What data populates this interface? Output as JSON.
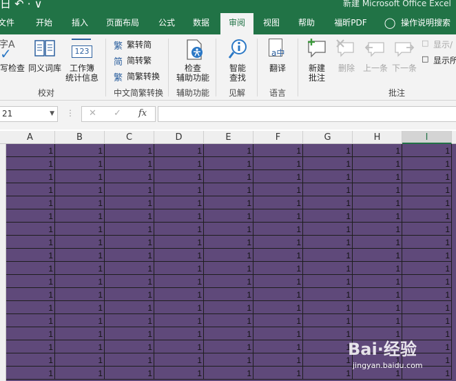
{
  "titlebar": {
    "qat": "日 ↶ · ∨",
    "title": "新建 Microsoft Office Excel"
  },
  "tabs": [
    {
      "label": "文件",
      "active": false
    },
    {
      "label": "开始",
      "active": false
    },
    {
      "label": "插入",
      "active": false
    },
    {
      "label": "页面布局",
      "active": false
    },
    {
      "label": "公式",
      "active": false
    },
    {
      "label": "数据",
      "active": false
    },
    {
      "label": "审阅",
      "active": true
    },
    {
      "label": "视图",
      "active": false
    },
    {
      "label": "帮助",
      "active": false
    },
    {
      "label": "福昕PDF",
      "active": false
    },
    {
      "label": "操作说明搜索",
      "active": false
    }
  ],
  "ribbon": {
    "proofing": {
      "spelling": "写检查",
      "thesaurus": "同义词库",
      "workbook_stats_1": "工作簿",
      "workbook_stats_2": "统计信息",
      "group": "校对"
    },
    "chinese": {
      "trad_to_simp": "繁转简",
      "simp_to_trad": "简转繁",
      "convert": "简繁转换",
      "group": "中文简繁转换"
    },
    "accessibility": {
      "check_1": "检查",
      "check_2": "辅助功能",
      "group": "辅助功能"
    },
    "insights": {
      "smart_1": "智能",
      "smart_2": "查找",
      "group": "见解"
    },
    "language": {
      "translate": "翻译",
      "group": "语言"
    },
    "comments": {
      "new_1": "新建",
      "new_2": "批注",
      "delete": "删除",
      "previous": "上一条",
      "next": "下一条",
      "show_hide": "显示/",
      "show_all": "显示所",
      "group": "批注"
    },
    "icon_text": {
      "spell_glyph": "字A",
      "stats_glyph": "123",
      "trad_glyph": "繁",
      "simp_glyph": "简",
      "conv_glyph": "繁",
      "translate_glyph": "a中"
    }
  },
  "formula_bar": {
    "name_box": "21",
    "cancel": "✕",
    "enter": "✓",
    "fx": "fx",
    "value": ""
  },
  "sheet": {
    "columns": [
      "A",
      "B",
      "C",
      "D",
      "E",
      "F",
      "G",
      "H",
      "I"
    ],
    "selected_column": "I",
    "cell_value": "1",
    "cell_fill": "#5f497a",
    "row_count": 18
  },
  "watermark": {
    "brand": "Bai·经验",
    "url": "jingyan.baidu.com"
  },
  "colors": {
    "excel_green": "#217346",
    "ribbon_bg": "#f3f3f3",
    "cell_fill": "#5f497a"
  }
}
